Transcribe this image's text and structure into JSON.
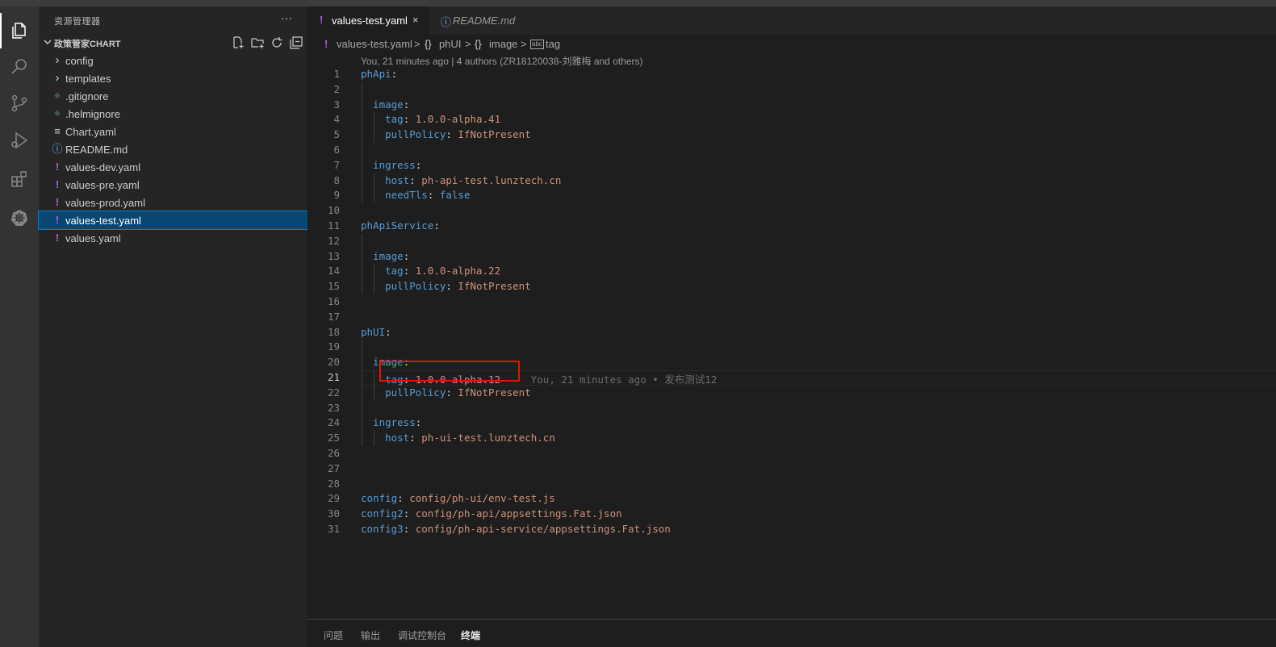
{
  "colors": {
    "accent": "#007fd4",
    "selection": "#094771",
    "yaml_icon": "#b05ee0",
    "highlight_box": "#e51400"
  },
  "activitybar": {
    "icons": [
      "explorer-icon",
      "search-icon",
      "source-control-icon",
      "run-debug-icon",
      "extensions-icon",
      "kubernetes-icon"
    ]
  },
  "sidebar": {
    "title": "资源管理器",
    "more": "···",
    "section_title": "政策管家CHART",
    "actions": [
      "new-file-icon",
      "new-folder-icon",
      "refresh-icon",
      "collapse-all-icon"
    ],
    "items": [
      {
        "label": "config",
        "icon": "chevron-right-icon",
        "glyph": "›"
      },
      {
        "label": "templates",
        "icon": "chevron-right-icon",
        "glyph": "›"
      },
      {
        "label": ".gitignore",
        "icon": "git-diamond-icon",
        "glyph": "◆"
      },
      {
        "label": ".helmignore",
        "icon": "git-diamond-icon",
        "glyph": "◆"
      },
      {
        "label": "Chart.yaml",
        "icon": "lines-icon",
        "glyph": "≡"
      },
      {
        "label": "README.md",
        "icon": "info-icon",
        "glyph": "ⓘ"
      },
      {
        "label": "values-dev.yaml",
        "icon": "yaml-icon",
        "glyph": "!"
      },
      {
        "label": "values-pre.yaml",
        "icon": "yaml-icon",
        "glyph": "!"
      },
      {
        "label": "values-prod.yaml",
        "icon": "yaml-icon",
        "glyph": "!"
      },
      {
        "label": "values-test.yaml",
        "icon": "yaml-icon",
        "glyph": "!",
        "selected": true
      },
      {
        "label": "values.yaml",
        "icon": "yaml-icon",
        "glyph": "!"
      }
    ]
  },
  "tabs": [
    {
      "label": "values-test.yaml",
      "icon": "!",
      "active": true,
      "close": "×"
    },
    {
      "label": "README.md",
      "icon": "ⓘ",
      "active": false
    }
  ],
  "breadcrumb": {
    "file": "values-test.yaml",
    "sep": ">",
    "obj1_icon": "{}",
    "obj1": "phUI",
    "obj2_icon": "{}",
    "obj2": "image",
    "field_icon": "abc",
    "field": "tag"
  },
  "codelens": "You, 21 minutes ago | 4 authors (ZR18120038-刘雅梅 and others)",
  "code_lines": [
    [
      {
        "t": "phApi",
        "c": "k"
      },
      {
        "t": ":",
        "c": "p"
      }
    ],
    [],
    [
      {
        "t": "  image",
        "c": "k"
      },
      {
        "t": ":",
        "c": "p"
      }
    ],
    [
      {
        "t": "    tag",
        "c": "k"
      },
      {
        "t": ": ",
        "c": "p"
      },
      {
        "t": "1.0.0-alpha.41",
        "c": "s"
      }
    ],
    [
      {
        "t": "    pullPolicy",
        "c": "k"
      },
      {
        "t": ": ",
        "c": "p"
      },
      {
        "t": "IfNotPresent",
        "c": "s"
      }
    ],
    [],
    [
      {
        "t": "  ingress",
        "c": "k"
      },
      {
        "t": ":",
        "c": "p"
      }
    ],
    [
      {
        "t": "    host",
        "c": "k"
      },
      {
        "t": ": ",
        "c": "p"
      },
      {
        "t": "ph-api-test.lunztech.cn",
        "c": "s"
      }
    ],
    [
      {
        "t": "    needTls",
        "c": "k"
      },
      {
        "t": ": ",
        "c": "p"
      },
      {
        "t": "false",
        "c": "b"
      }
    ],
    [],
    [
      {
        "t": "phApiService",
        "c": "k"
      },
      {
        "t": ":",
        "c": "p"
      }
    ],
    [],
    [
      {
        "t": "  image",
        "c": "k"
      },
      {
        "t": ":",
        "c": "p"
      }
    ],
    [
      {
        "t": "    tag",
        "c": "k"
      },
      {
        "t": ": ",
        "c": "p"
      },
      {
        "t": "1.0.0-alpha.22",
        "c": "s"
      }
    ],
    [
      {
        "t": "    pullPolicy",
        "c": "k"
      },
      {
        "t": ": ",
        "c": "p"
      },
      {
        "t": "IfNotPresent",
        "c": "s"
      }
    ],
    [],
    [],
    [
      {
        "t": "phUI",
        "c": "k"
      },
      {
        "t": ":",
        "c": "p"
      }
    ],
    [],
    [
      {
        "t": "  image",
        "c": "k"
      },
      {
        "t": ":",
        "c": "p"
      }
    ],
    [
      {
        "t": "    tag",
        "c": "k"
      },
      {
        "t": ": ",
        "c": "p"
      },
      {
        "t": "1.0.0-alpha.12",
        "c": "s"
      },
      {
        "t": "     You, 21 minutes ago • 发布测试12",
        "c": "blame"
      }
    ],
    [
      {
        "t": "    pullPolicy",
        "c": "k"
      },
      {
        "t": ": ",
        "c": "p"
      },
      {
        "t": "IfNotPresent",
        "c": "s"
      }
    ],
    [],
    [
      {
        "t": "  ingress",
        "c": "k"
      },
      {
        "t": ":",
        "c": "p"
      }
    ],
    [
      {
        "t": "    host",
        "c": "k"
      },
      {
        "t": ": ",
        "c": "p"
      },
      {
        "t": "ph-ui-test.lunztech.cn",
        "c": "s"
      }
    ],
    [],
    [],
    [],
    [
      {
        "t": "config",
        "c": "k"
      },
      {
        "t": ": ",
        "c": "p"
      },
      {
        "t": "config/ph-ui/env-test.js",
        "c": "s"
      }
    ],
    [
      {
        "t": "config2",
        "c": "k"
      },
      {
        "t": ": ",
        "c": "p"
      },
      {
        "t": "config/ph-api/appsettings.Fat.json",
        "c": "s"
      }
    ],
    [
      {
        "t": "config3",
        "c": "k"
      },
      {
        "t": ": ",
        "c": "p"
      },
      {
        "t": "config/ph-api-service/appsettings.Fat.json",
        "c": "s"
      }
    ]
  ],
  "current_line": 21,
  "highlighted_line": 21,
  "panel_tabs": [
    {
      "label": "问题",
      "active": false
    },
    {
      "label": "输出",
      "active": false
    },
    {
      "label": "调试控制台",
      "active": false
    },
    {
      "label": "终端",
      "active": true
    }
  ]
}
